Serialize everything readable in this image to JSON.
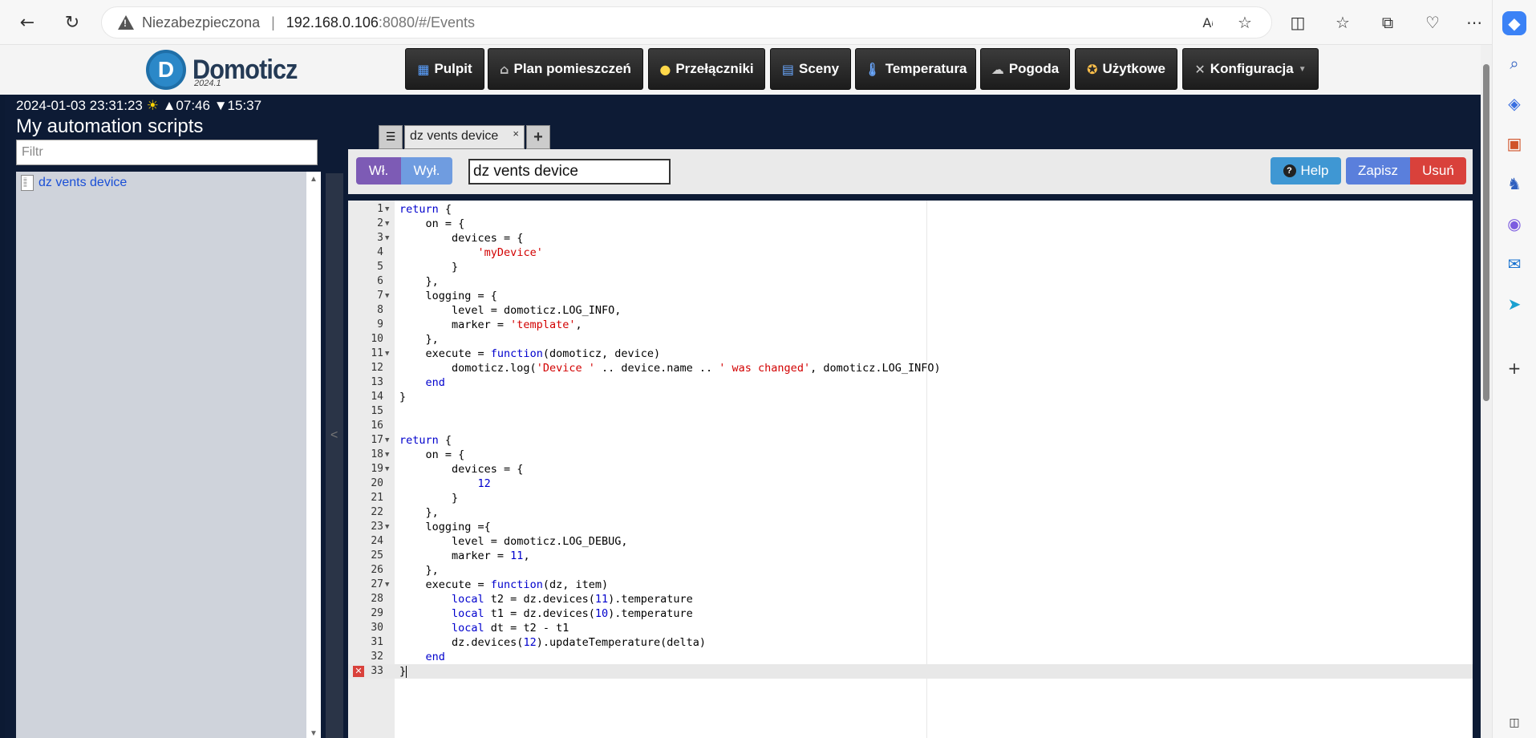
{
  "browser": {
    "security_label": "Niezabezpieczona",
    "url_host": "192.168.0.106",
    "url_rest": ":8080/#/Events"
  },
  "app": {
    "logo_text": "Domoticz",
    "logo_version": "2024.1",
    "nav": [
      {
        "label": "Pulpit",
        "icon": "dashboard-icon"
      },
      {
        "label": "Plan pomieszczeń",
        "icon": "house-icon"
      },
      {
        "label": "Przełączniki",
        "icon": "lightbulb-icon"
      },
      {
        "label": "Sceny",
        "icon": "clapperboard-icon"
      },
      {
        "label": "Temperatura",
        "icon": "thermometer-icon"
      },
      {
        "label": "Pogoda",
        "icon": "weather-icon"
      },
      {
        "label": "Użytkowe",
        "icon": "utility-icon"
      },
      {
        "label": "Konfiguracja",
        "icon": "tools-icon"
      }
    ]
  },
  "sidebar": {
    "datetime": "2024-01-03 23:31:23",
    "sunrise": "▲07:46",
    "sunset": "▼15:37",
    "title": "My automation scripts",
    "filter_placeholder": "Filtr",
    "scripts": [
      "dz vents device"
    ]
  },
  "editor": {
    "tab_label": "dz vents device",
    "tab_close": "×",
    "tab_add": "+",
    "btn_on": "Wł.",
    "btn_off": "Wył.",
    "script_name": "dz vents device",
    "btn_help": "Help",
    "btn_save": "Zapisz",
    "btn_delete": "Usuń",
    "error_line": 33,
    "lines": [
      "return {",
      "    on = {",
      "        devices = {",
      "            'myDevice'",
      "        }",
      "    },",
      "    logging = {",
      "        level = domoticz.LOG_INFO,",
      "        marker = 'template',",
      "    },",
      "    execute = function(domoticz, device)",
      "        domoticz.log('Device ' .. device.name .. ' was changed', domoticz.LOG_INFO)",
      "    end",
      "}",
      "",
      "",
      "return {",
      "    on = {",
      "        devices = {",
      "            12",
      "        }",
      "    },",
      "    logging ={",
      "        level = domoticz.LOG_DEBUG,",
      "        marker = 11,",
      "    },",
      "    execute = function(dz, item)",
      "        local t2 = dz.devices(11).temperature",
      "        local t1 = dz.devices(10).temperature",
      "        local dt = t2 - t1",
      "        dz.devices(12).updateTemperature(delta)",
      "    end",
      "}"
    ],
    "fold_lines": [
      1,
      2,
      3,
      7,
      11,
      17,
      18,
      19,
      23,
      27
    ]
  }
}
